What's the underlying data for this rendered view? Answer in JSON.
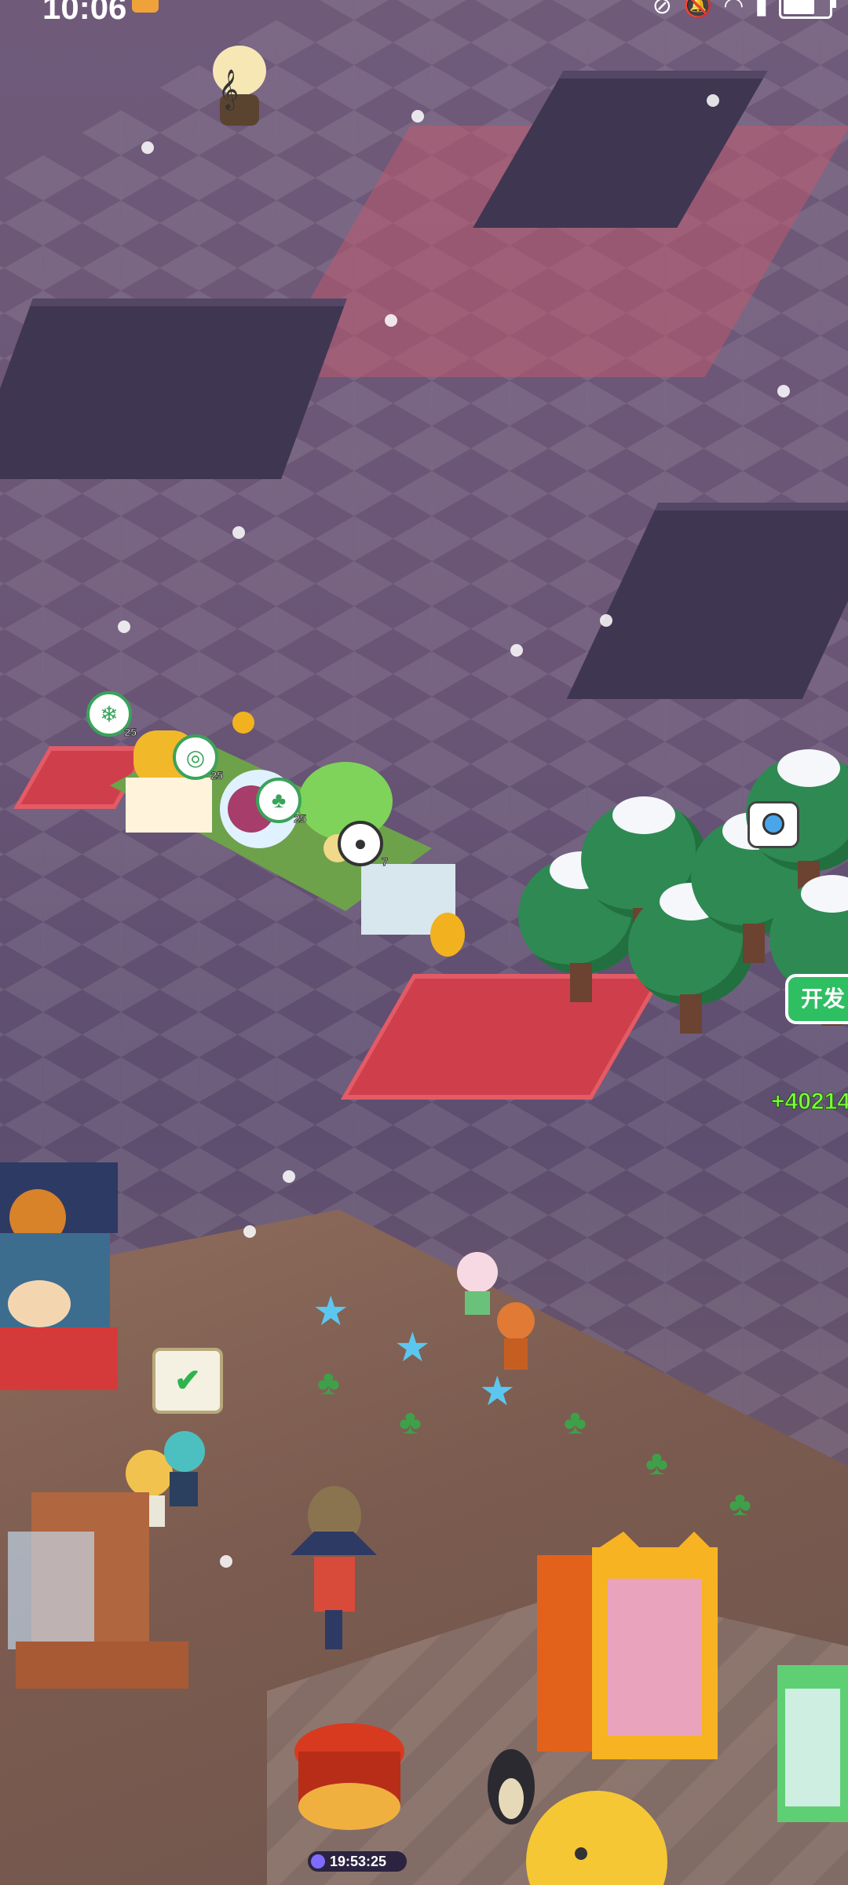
{
  "status_bar": {
    "time": "10:06",
    "icons": [
      "mute-icon",
      "bell-off-icon",
      "wifi-icon",
      "signal-icon",
      "battery-icon"
    ],
    "battery_level": 0.7
  },
  "game": {
    "development_tag": "开发",
    "resource_counter": "+40214",
    "bottom_timer": "19:53:25",
    "building_levels": [
      "25",
      "25",
      "25",
      "7"
    ],
    "colors": {
      "red_zone": "#cf3f4b",
      "floor": "#6f5a7a",
      "accent_green": "#2fbf63"
    }
  }
}
